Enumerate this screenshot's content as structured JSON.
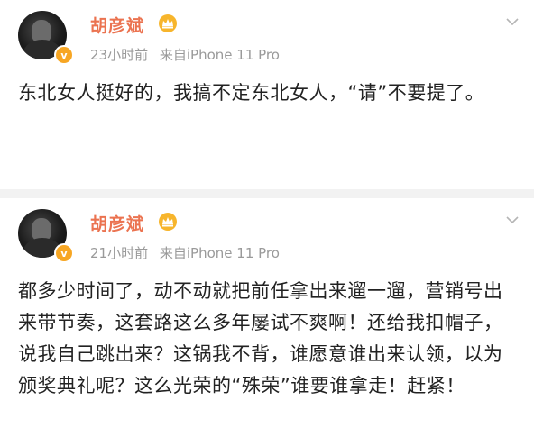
{
  "posts": [
    {
      "author": "胡彦斌",
      "time": "23小时前",
      "source": "来自iPhone 11 Pro",
      "verified": "v",
      "text": "东北女人挺好的，我搞不定东北女人，“请”不要提了。"
    },
    {
      "author": "胡彦斌",
      "time": "21小时前",
      "source": "来自iPhone 11 Pro",
      "verified": "v",
      "text": "都多少时间了，动不动就把前任拿出来遛一遛，营销号出来带节奏，这套路这么多年屡试不爽啊！还给我扣帽子，说我自己跳出来？这锅我不背，谁愿意谁出来认领，以为颁奖典礼呢？这么光荣的“殊荣”谁要谁拿走！赶紧！"
    }
  ],
  "colors": {
    "name": "#eb7350",
    "meta": "#9a9a9a",
    "badge": "#f7a623",
    "divider": "#f2f2f2"
  },
  "icons": [
    "avatar",
    "verified-badge-icon",
    "crown-icon",
    "chevron-down-icon"
  ]
}
